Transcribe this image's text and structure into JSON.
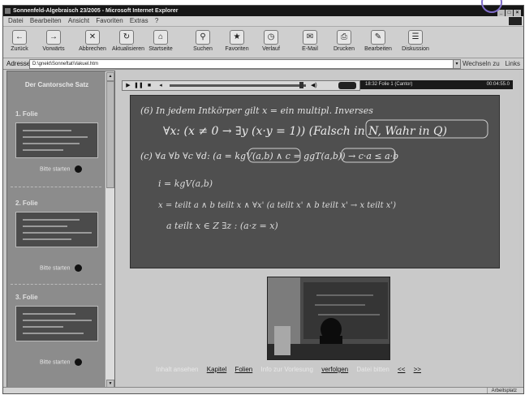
{
  "window": {
    "title": "Sonnenfeld-Algebraisch 23/2005 - Microsoft Internet Explorer"
  },
  "menu": [
    "Datei",
    "Bearbeiten",
    "Ansicht",
    "Favoriten",
    "Extras",
    "?"
  ],
  "toolbar": [
    {
      "label": "Zurück",
      "icon": "back-arrow-icon",
      "glyph": "←"
    },
    {
      "label": "Vorwärts",
      "icon": "forward-arrow-icon",
      "glyph": "→"
    },
    {
      "label": "Abbrechen",
      "icon": "stop-icon",
      "glyph": "✕"
    },
    {
      "label": "Aktualisieren",
      "icon": "refresh-icon",
      "glyph": "↻"
    },
    {
      "label": "Startseite",
      "icon": "home-icon",
      "glyph": "⌂"
    },
    {
      "label": "Suchen",
      "icon": "search-icon",
      "glyph": "⚲"
    },
    {
      "label": "Favoriten",
      "icon": "favorites-icon",
      "glyph": "★"
    },
    {
      "label": "Verlauf",
      "icon": "history-icon",
      "glyph": "◷"
    },
    {
      "label": "E-Mail",
      "icon": "mail-icon",
      "glyph": "✉"
    },
    {
      "label": "Drucken",
      "icon": "print-icon",
      "glyph": "⎙"
    },
    {
      "label": "Bearbeiten",
      "icon": "edit-icon",
      "glyph": "✎"
    },
    {
      "label": "Diskussion",
      "icon": "discuss-icon",
      "glyph": "☰"
    }
  ],
  "address": {
    "label": "Adresse",
    "value": "D:\\gnekt\\Sonneftat\\Vakuel.htm",
    "go": "Wechseln zu",
    "links": "Links"
  },
  "sidebar": {
    "title": "Der Cantorsche Satz",
    "slides": [
      {
        "num": "1. Folie",
        "more": "Bitte starten"
      },
      {
        "num": "2. Folie",
        "more": "Bitte starten"
      },
      {
        "num": "3. Folie",
        "more": "Bitte starten"
      }
    ]
  },
  "player": {
    "status": "18:32 Folie 1 (Cantor)",
    "time": "00:04:55.0"
  },
  "board": {
    "lines": [
      "(6)  In jedem Intkörper gilt x = ein multipl. Inverses",
      "∀x: (x ≠ 0 → ∃y (x·y = 1))   (Falsch in N, Wahr in Q)",
      "(c)  ∀a ∀b ∀c ∀d: (a = kgV(a,b) ∧ c = ggT(a,b)) → c·a ≤ a·b",
      "i = kgV(a,b)",
      "x = teilt a ∧ b teilt x ∧ ∀x' (a teilt x' ∧ b teilt x' → x teilt x')",
      "a teilt x ∈ Z  ∃z : (a·z = x)"
    ]
  },
  "links": [
    {
      "text": "Inhalt ansehen",
      "plain": true
    },
    {
      "text": "Kapitel",
      "plain": false
    },
    {
      "text": "Folien",
      "plain": false
    },
    {
      "text": "Info zur Vorlesung",
      "plain": true
    },
    {
      "text": "verfolgen",
      "plain": false
    },
    {
      "text": "Datei bitten",
      "plain": true
    },
    {
      "text": "<<",
      "plain": false
    },
    {
      "text": ">>",
      "plain": false
    }
  ],
  "statusbar": {
    "zone": "Arbeitsplatz"
  }
}
